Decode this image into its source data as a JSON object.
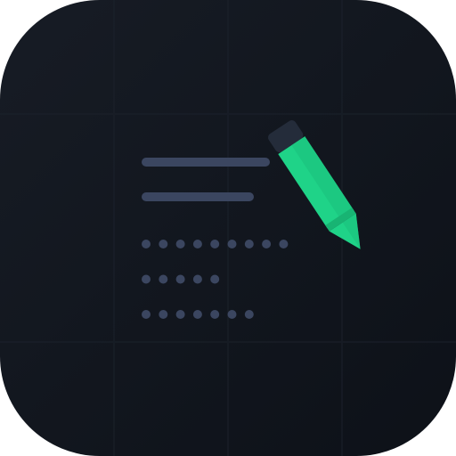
{
  "app_icon": {
    "icon_name": "notes-with-pencil-icon",
    "colors": {
      "tile_top": "#161b23",
      "tile_bottom": "#0f131a",
      "text_lines": "#3b4660",
      "dots": "#3b4660",
      "pencil_body": "#1fd388",
      "pencil_shade": "#18b473",
      "pencil_cap": "#242c3a",
      "pencil_tip": "#1fd388"
    },
    "text_line_count": 2,
    "dot_rows": [
      9,
      5,
      7
    ]
  }
}
